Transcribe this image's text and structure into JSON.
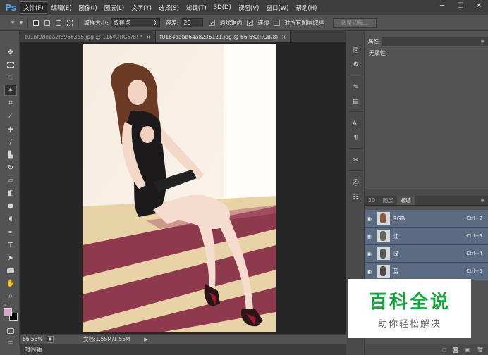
{
  "app": {
    "logo": "Ps"
  },
  "menu": [
    "文件(F)",
    "编辑(E)",
    "图像(I)",
    "图层(L)",
    "文字(Y)",
    "选择(S)",
    "滤镜(T)",
    "3D(D)",
    "视图(V)",
    "窗口(W)",
    "帮助(H)"
  ],
  "window_controls": {
    "minimize": "─",
    "restore": "☐",
    "close": "✕"
  },
  "options": {
    "sample_size_label": "取样大小:",
    "sample_size_value": "取样点",
    "tolerance_label": "容差:",
    "tolerance_value": "20",
    "antialias_label": "消除锯齿",
    "antialias_checked": true,
    "contiguous_label": "连续",
    "contiguous_checked": true,
    "all_layers_label": "对所有图层取样",
    "all_layers_checked": false,
    "refine_edge_label": "调整边缘..."
  },
  "doc_tabs": [
    {
      "label": "t01bf9deea2f89683d5.jpg @ 116%(RGB/8) *",
      "active": false
    },
    {
      "label": "t0164aabb64a8236121.jpg @ 66.6%(RGB/8)",
      "active": true
    }
  ],
  "status": {
    "zoom": "66.55%",
    "doc_info": "文档:1.55M/1.55M"
  },
  "timeline": {
    "label": "时间轴"
  },
  "properties": {
    "tab": "属性",
    "empty_text": "无属性"
  },
  "channel_panel": {
    "tabs": [
      "3D",
      "图层",
      "通道"
    ],
    "active_tab": "通道",
    "channels": [
      {
        "name": "RGB",
        "shortcut": "Ctrl+2"
      },
      {
        "name": "红",
        "shortcut": "Ctrl+3"
      },
      {
        "name": "绿",
        "shortcut": "Ctrl+4"
      },
      {
        "name": "蓝",
        "shortcut": "Ctrl+5"
      }
    ]
  },
  "watermark": {
    "title": "百科全说",
    "subtitle": "助你轻松解决"
  },
  "colors": {
    "accent_blue": "#4ea3f5",
    "channel_row": "#5a6b82",
    "watermark_green": "#15a63c",
    "foreground": "#d8a6c8",
    "background": "#000000"
  }
}
